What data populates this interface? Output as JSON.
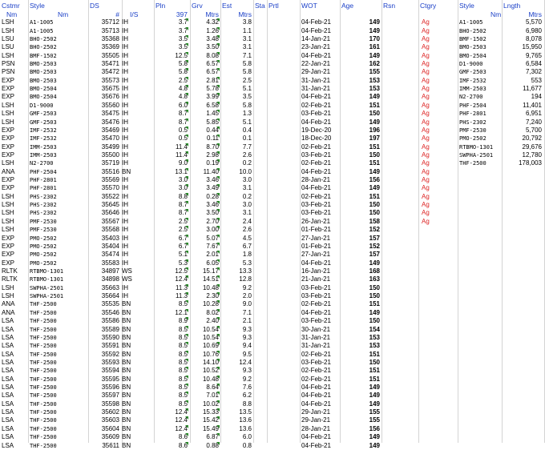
{
  "header": {
    "row1": {
      "Cstmr": "Cstmr",
      "Style": "Style",
      "DS": "DS",
      "Pln": "Pln",
      "Grv": "Grv",
      "Est": "Est",
      "Sta": "Sta",
      "Prtl": "Prtl",
      "WOT": "WOT",
      "Age": "Age",
      "Rsn": "Rsn",
      "Ctgry": "Ctgry",
      "Style2": "Style",
      "Lngth": "Lngth"
    },
    "row2": {
      "Nm": "Nm",
      "Nm2": "Nm",
      "hash": "#",
      "IS": "I/S",
      "pln": "397",
      "Mtrs": "Mtrs",
      "Mtrs2": "Mtrs",
      "Nm3": "Nm",
      "Mtrs3": "Mtrs"
    }
  },
  "rows": [
    [
      "LSH",
      "A1-1005",
      "35712",
      "IH",
      "3.7",
      "4.32",
      "3.8",
      "04-Feb-21",
      "149"
    ],
    [
      "LSH",
      "A1-1005",
      "35713",
      "IH",
      "3.7",
      "1.26",
      "1.1",
      "04-Feb-21",
      "149"
    ],
    [
      "LSU",
      "BHO-2502",
      "35368",
      "IH",
      "3.5",
      "3.48",
      "3.1",
      "14-Jan-21",
      "170"
    ],
    [
      "LSU",
      "BHO-2502",
      "35369",
      "IH",
      "3.5",
      "3.50",
      "3.1",
      "23-Jan-21",
      "161"
    ],
    [
      "LSH",
      "BMF-1502",
      "35505",
      "IH",
      "12.5",
      "8.08",
      "7.1",
      "04-Feb-21",
      "149"
    ],
    [
      "PSN",
      "BMO-2503",
      "35471",
      "IH",
      "5.8",
      "6.57",
      "5.8",
      "22-Jan-21",
      "162"
    ],
    [
      "PSN",
      "BMO-2503",
      "35472",
      "IH",
      "5.8",
      "6.57",
      "5.8",
      "29-Jan-21",
      "155"
    ],
    [
      "EXP",
      "BMO-2503",
      "35573",
      "IH",
      "2.5",
      "2.81",
      "2.5",
      "31-Jan-21",
      "153"
    ],
    [
      "EXP",
      "BMO-2504",
      "35675",
      "IH",
      "4.8",
      "5.78",
      "5.1",
      "31-Jan-21",
      "153"
    ],
    [
      "EXP",
      "BMO-2504",
      "35676",
      "IH",
      "4.8",
      "3.99",
      "3.5",
      "04-Feb-21",
      "149"
    ],
    [
      "LSH",
      "D1-9000",
      "35560",
      "IH",
      "6.0",
      "6.58",
      "5.8",
      "02-Feb-21",
      "151"
    ],
    [
      "LSH",
      "GMF-2503",
      "35475",
      "IH",
      "8.7",
      "1.45",
      "1.3",
      "03-Feb-21",
      "150"
    ],
    [
      "LSH",
      "GMF-2503",
      "35476",
      "IH",
      "8.7",
      "5.85",
      "5.1",
      "04-Feb-21",
      "149"
    ],
    [
      "EXP",
      "IMF-2532",
      "35469",
      "IH",
      "0.5",
      "0.44",
      "0.4",
      "19-Dec-20",
      "196"
    ],
    [
      "EXP",
      "IMF-2532",
      "35470",
      "IH",
      "0.5",
      "0.11",
      "0.1",
      "18-Dec-20",
      "197"
    ],
    [
      "EXP",
      "IMM-2503",
      "35499",
      "IH",
      "11.4",
      "8.70",
      "7.7",
      "02-Feb-21",
      "151"
    ],
    [
      "EXP",
      "IMM-2503",
      "35500",
      "IH",
      "11.4",
      "2.98",
      "2.6",
      "03-Feb-21",
      "150"
    ],
    [
      "LSH",
      "N2-2700",
      "35719",
      "IH",
      "9.0",
      "0.19",
      "0.2",
      "02-Feb-21",
      "151"
    ],
    [
      "ANA",
      "PHF-2504",
      "35516",
      "BN",
      "13.1",
      "11.40",
      "10.0",
      "04-Feb-21",
      "149"
    ],
    [
      "EXP",
      "PHF-2801",
      "35569",
      "IH",
      "3.0",
      "3.46",
      "3.0",
      "28-Jan-21",
      "156"
    ],
    [
      "EXP",
      "PHF-2801",
      "35570",
      "IH",
      "3.0",
      "3.49",
      "3.1",
      "04-Feb-21",
      "149"
    ],
    [
      "LSH",
      "PHS-2302",
      "35522",
      "IH",
      "8.8",
      "0.28",
      "0.2",
      "02-Feb-21",
      "151"
    ],
    [
      "LSH",
      "PHS-2302",
      "35645",
      "IH",
      "8.7",
      "3.46",
      "3.0",
      "03-Feb-21",
      "150"
    ],
    [
      "LSH",
      "PHS-2302",
      "35646",
      "IH",
      "8.7",
      "3.50",
      "3.1",
      "03-Feb-21",
      "150"
    ],
    [
      "LSH",
      "PMF-2530",
      "35567",
      "IH",
      "2.5",
      "2.70",
      "2.4",
      "26-Jan-21",
      "158"
    ],
    [
      "LSH",
      "PMF-2530",
      "35568",
      "IH",
      "2.5",
      "3.00",
      "2.6",
      "01-Feb-21",
      "152"
    ],
    [
      "EXP",
      "PMO-2502",
      "35403",
      "IH",
      "6.7",
      "5.07",
      "4.5",
      "27-Jan-21",
      "157"
    ],
    [
      "EXP",
      "PMO-2502",
      "35404",
      "IH",
      "6.7",
      "7.67",
      "6.7",
      "01-Feb-21",
      "152"
    ],
    [
      "EXP",
      "PMO-2502",
      "35474",
      "IH",
      "5.1",
      "2.01",
      "1.8",
      "27-Jan-21",
      "157"
    ],
    [
      "EXP",
      "PMO-2502",
      "35583",
      "IH",
      "5.3",
      "6.05",
      "5.3",
      "04-Feb-21",
      "149"
    ],
    [
      "RLTK",
      "RTBMO-1301",
      "34897",
      "WS",
      "12.5",
      "15.17",
      "13.3",
      "16-Jan-21",
      "168"
    ],
    [
      "RLTK",
      "RTBMO-1301",
      "34898",
      "WS",
      "12.4",
      "14.51",
      "12.8",
      "21-Jan-21",
      "163"
    ],
    [
      "LSH",
      "SWPHA-2501",
      "35663",
      "IH",
      "11.3",
      "10.48",
      "9.2",
      "03-Feb-21",
      "150"
    ],
    [
      "LSH",
      "SWPHA-2501",
      "35664",
      "IH",
      "11.3",
      "2.30",
      "2.0",
      "03-Feb-21",
      "150"
    ],
    [
      "ANA",
      "THF-2500",
      "35535",
      "BN",
      "8.5",
      "10.28",
      "9.0",
      "02-Feb-21",
      "151"
    ],
    [
      "ANA",
      "THF-2500",
      "35546",
      "BN",
      "12.1",
      "8.02",
      "7.1",
      "04-Feb-21",
      "149"
    ],
    [
      "LSA",
      "THF-2500",
      "35586",
      "BN",
      "8.9",
      "2.40",
      "2.1",
      "03-Feb-21",
      "150"
    ],
    [
      "LSA",
      "THF-2500",
      "35589",
      "BN",
      "8.5",
      "10.54",
      "9.3",
      "30-Jan-21",
      "154"
    ],
    [
      "LSA",
      "THF-2500",
      "35590",
      "BN",
      "8.5",
      "10.54",
      "9.3",
      "31-Jan-21",
      "153"
    ],
    [
      "LSA",
      "THF-2500",
      "35591",
      "BN",
      "8.5",
      "10.69",
      "9.4",
      "31-Jan-21",
      "153"
    ],
    [
      "LSA",
      "THF-2500",
      "35592",
      "BN",
      "8.5",
      "10.76",
      "9.5",
      "02-Feb-21",
      "151"
    ],
    [
      "LSA",
      "THF-2500",
      "35593",
      "BN",
      "8.5",
      "14.10",
      "12.4",
      "03-Feb-21",
      "150"
    ],
    [
      "LSA",
      "THF-2500",
      "35594",
      "BN",
      "8.5",
      "10.52",
      "9.3",
      "02-Feb-21",
      "151"
    ],
    [
      "LSA",
      "THF-2500",
      "35595",
      "BN",
      "8.5",
      "10.48",
      "9.2",
      "02-Feb-21",
      "151"
    ],
    [
      "LSA",
      "THF-2500",
      "35596",
      "BN",
      "8.5",
      "8.64",
      "7.6",
      "04-Feb-21",
      "149"
    ],
    [
      "LSA",
      "THF-2500",
      "35597",
      "BN",
      "8.5",
      "7.01",
      "6.2",
      "04-Feb-21",
      "149"
    ],
    [
      "LSA",
      "THF-2500",
      "35598",
      "BN",
      "8.5",
      "10.02",
      "8.8",
      "04-Feb-21",
      "149"
    ],
    [
      "LSA",
      "THF-2500",
      "35602",
      "BN",
      "12.4",
      "15.33",
      "13.5",
      "29-Jan-21",
      "155"
    ],
    [
      "LSA",
      "THF-2500",
      "35603",
      "BN",
      "12.4",
      "15.42",
      "13.6",
      "29-Jan-21",
      "155"
    ],
    [
      "LSA",
      "THF-2500",
      "35604",
      "BN",
      "12.4",
      "15.49",
      "13.6",
      "28-Jan-21",
      "156"
    ],
    [
      "LSA",
      "THF-2500",
      "35609",
      "BN",
      "8.6",
      "6.87",
      "6.0",
      "04-Feb-21",
      "149"
    ],
    [
      "LSA",
      "THF-2500",
      "35611",
      "BN",
      "8.6",
      "0.88",
      "0.8",
      "04-Feb-21",
      "149"
    ]
  ],
  "ctgry": [
    "Ag",
    "Ag",
    "Ag",
    "Ag",
    "Ag",
    "Ag",
    "Ag",
    "Ag",
    "Ag",
    "Ag",
    "Ag",
    "Ag",
    "Ag",
    "Ag",
    "Ag",
    "Ag",
    "Ag",
    "Ag",
    "Ag",
    "Ag",
    "Ag",
    "Ag",
    "Ag",
    "Ag",
    "Ag"
  ],
  "summary": [
    [
      "A1-1005",
      "5,570"
    ],
    [
      "BHO-2502",
      "6,980"
    ],
    [
      "BMF-1502",
      "8,078"
    ],
    [
      "BMO-2503",
      "15,950"
    ],
    [
      "BMO-2504",
      "9,765"
    ],
    [
      "D1-9000",
      "6,584"
    ],
    [
      "GMF-2503",
      "7,302"
    ],
    [
      "IMF-2532",
      "553"
    ],
    [
      "IMM-2503",
      "11,677"
    ],
    [
      "N2-2700",
      "194"
    ],
    [
      "PHF-2504",
      "11,401"
    ],
    [
      "PHF-2801",
      "6,951"
    ],
    [
      "PHS-2302",
      "7,240"
    ],
    [
      "PMF-2530",
      "5,700"
    ],
    [
      "PMO-2502",
      "20,792"
    ],
    [
      "RTBMO-1301",
      "29,676"
    ],
    [
      "SWPHA-2501",
      "12,780"
    ],
    [
      "THF-2500",
      "178,003"
    ]
  ],
  "colors": {
    "header_text": "#1a3fc7",
    "category_text": "#d22",
    "grid": "#d4d4d4",
    "marker": "#2a8a2a"
  }
}
